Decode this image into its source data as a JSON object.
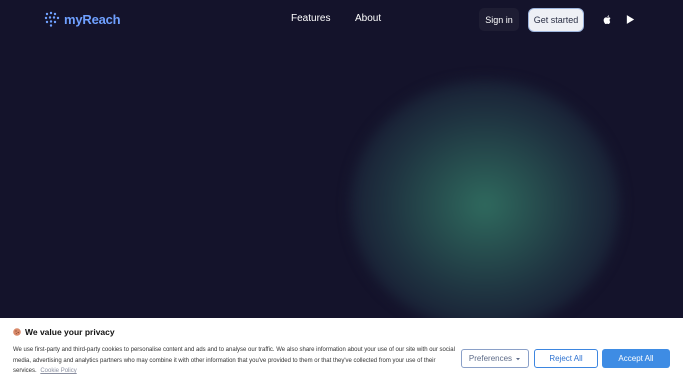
{
  "header": {
    "brand": "myReach",
    "nav": [
      {
        "label": "Features"
      },
      {
        "label": "About"
      }
    ],
    "sign_in": "Sign in",
    "get_started": "Get started",
    "store_icons": [
      "apple-icon",
      "google-play-icon"
    ]
  },
  "colors": {
    "background": "#14132b",
    "brand_blue": "#6fa0ff",
    "glow": "#2f6a5e",
    "accept_button": "#3e8ce4"
  },
  "cookie_banner": {
    "title": "We value your privacy",
    "body": "We use first-party and third-party cookies to personalise content and ads and to analyse our traffic. We also share information about your use of our site with our social media, advertising and analytics partners who may combine it with other information that you've provided to them or that they've collected from your use of their services.",
    "policy_link": "Cookie Policy",
    "preferences": "Preferences",
    "reject_all": "Reject All",
    "accept_all": "Accept All"
  }
}
